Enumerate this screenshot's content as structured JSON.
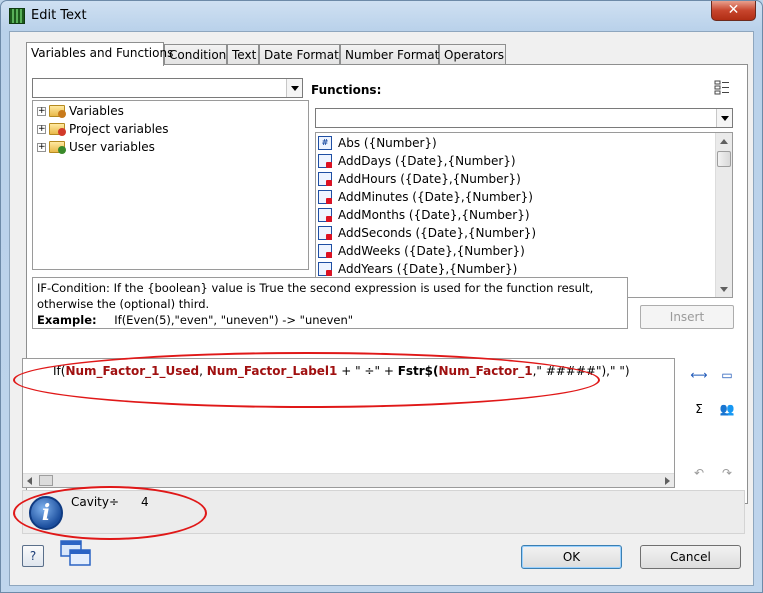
{
  "window": {
    "title": "Edit Text",
    "close_label": "✕"
  },
  "tabs": [
    {
      "label": "Variables and Functions",
      "active": true
    },
    {
      "label": "Condition"
    },
    {
      "label": "Text"
    },
    {
      "label": "Date Format"
    },
    {
      "label": "Number Format"
    },
    {
      "label": "Operators"
    }
  ],
  "variables_tree": {
    "items": [
      {
        "label": "Variables",
        "icon": "folder-variables-icon"
      },
      {
        "label": "Project variables",
        "icon": "folder-project-icon"
      },
      {
        "label": "User variables",
        "icon": "folder-user-icon"
      }
    ]
  },
  "functions": {
    "title": "Functions:",
    "items": [
      {
        "label": "Abs ({Number})",
        "icon": "number-function-icon"
      },
      {
        "label": "AddDays ({Date},{Number})",
        "icon": "date-function-icon"
      },
      {
        "label": "AddHours ({Date},{Number})",
        "icon": "date-function-icon"
      },
      {
        "label": "AddMinutes ({Date},{Number})",
        "icon": "date-function-icon"
      },
      {
        "label": "AddMonths ({Date},{Number})",
        "icon": "date-function-icon"
      },
      {
        "label": "AddSeconds ({Date},{Number})",
        "icon": "date-function-icon"
      },
      {
        "label": "AddWeeks ({Date},{Number})",
        "icon": "date-function-icon"
      },
      {
        "label": "AddYears ({Date},{Number})",
        "icon": "date-function-icon"
      }
    ]
  },
  "description": {
    "text": "IF-Condition: If the {boolean} value is True the second expression is used for the function result, otherwise the (optional) third.",
    "example_label": "Example:",
    "example_value": "If(Even(5),\"even\", \"uneven\") -> \"uneven\""
  },
  "insert_label": "Insert",
  "expression": {
    "p1": "If(",
    "v1": "Num_Factor_1_Used",
    "p2": ", ",
    "v2": "Num_Factor_Label1",
    "p3": " + \" ÷\" + ",
    "v3": "Fstr$(",
    "v4": "Num_Factor_1",
    "p4": ",\"  #####\"),\" \")"
  },
  "status": {
    "label": "Cavity÷",
    "value": "4"
  },
  "buttons": {
    "ok": "OK",
    "cancel": "Cancel",
    "help": "?"
  },
  "colors": {
    "annotation": "#e01818",
    "expression_field": "#a01010"
  }
}
